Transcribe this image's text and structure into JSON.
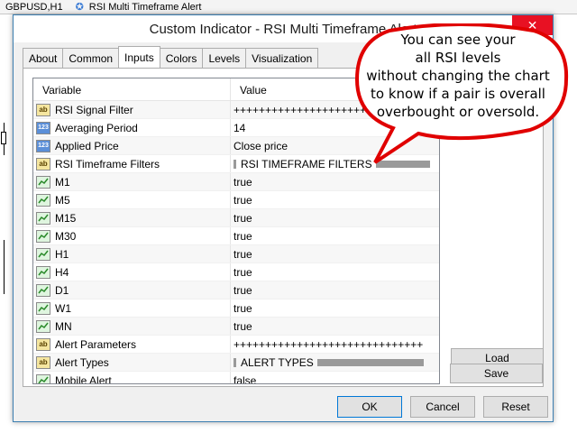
{
  "chart": {
    "symbol": "GBPUSD,H1",
    "indicator_name": "RSI Multi Timeframe Alert"
  },
  "dialog": {
    "title": "Custom Indicator - RSI Multi Timeframe Alert",
    "tabs": [
      {
        "label": "About"
      },
      {
        "label": "Common"
      },
      {
        "label": "Inputs"
      },
      {
        "label": "Colors"
      },
      {
        "label": "Levels"
      },
      {
        "label": "Visualization"
      }
    ],
    "active_tab": "Inputs",
    "grid": {
      "headers": {
        "variable": "Variable",
        "value": "Value"
      },
      "rows": [
        {
          "icon": "string-icon",
          "variable": "RSI Signal Filter",
          "value": "++++++++++++++++++++++++++++++"
        },
        {
          "icon": "number-icon",
          "variable": "Averaging Period",
          "value": "14"
        },
        {
          "icon": "number-icon",
          "variable": "Applied Price",
          "value": "Close price"
        },
        {
          "icon": "string-icon",
          "variable": "RSI Timeframe Filters",
          "value": "RSI TIMEFRAME FILTERS"
        },
        {
          "icon": "bool-icon",
          "variable": "M1",
          "value": "true"
        },
        {
          "icon": "bool-icon",
          "variable": "M5",
          "value": "true"
        },
        {
          "icon": "bool-icon",
          "variable": "M15",
          "value": "true"
        },
        {
          "icon": "bool-icon",
          "variable": "M30",
          "value": "true"
        },
        {
          "icon": "bool-icon",
          "variable": "H1",
          "value": "true"
        },
        {
          "icon": "bool-icon",
          "variable": "H4",
          "value": "true"
        },
        {
          "icon": "bool-icon",
          "variable": "D1",
          "value": "true"
        },
        {
          "icon": "bool-icon",
          "variable": "W1",
          "value": "true"
        },
        {
          "icon": "bool-icon",
          "variable": "MN",
          "value": "true"
        },
        {
          "icon": "string-icon",
          "variable": "Alert Parameters",
          "value": "++++++++++++++++++++++++++++++"
        },
        {
          "icon": "string-icon",
          "variable": "Alert Types",
          "value": "ALERT TYPES"
        },
        {
          "icon": "bool-icon",
          "variable": "Mobile Alert",
          "value": "false"
        }
      ]
    },
    "side_buttons": {
      "load": "Load",
      "save": "Save"
    },
    "footer_buttons": {
      "ok": "OK",
      "cancel": "Cancel",
      "reset": "Reset"
    }
  },
  "callout": {
    "lines": [
      "You can see your",
      "all RSI levels",
      "without changing the chart",
      "to know if a pair is overall",
      "overbought or oversold."
    ]
  },
  "colors": {
    "close": "#e81123",
    "bubble_fill": "#ffffff",
    "bubble_border": "#e00000",
    "accent": "#0078d7"
  }
}
